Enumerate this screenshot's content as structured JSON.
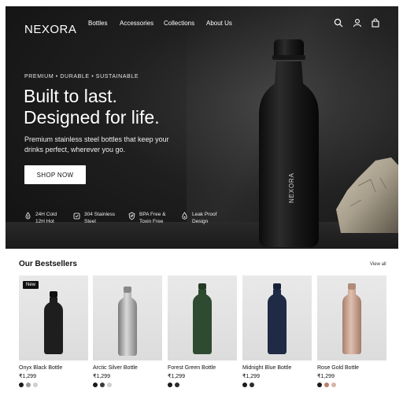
{
  "brand": "NEXORA",
  "nav": {
    "items": [
      "Bottles",
      "Accessories",
      "Collections",
      "About Us"
    ]
  },
  "header_icons": [
    "search-icon",
    "user-icon",
    "cart-icon"
  ],
  "hero": {
    "eyebrow": "PREMIUM • DURABLE • SUSTAINABLE",
    "headline_line1": "Built to last.",
    "headline_line2": "Designed for life.",
    "subcopy": "Premium stainless steel bottles that keep your drinks perfect, wherever you go.",
    "cta_label": "SHOP NOW",
    "bottle_brand": "NEXORA",
    "features": [
      {
        "icon": "thermometer-icon",
        "line1": "24H Cold",
        "line2": "12H Hot"
      },
      {
        "icon": "steel-badge-icon",
        "line1": "304 Stainless",
        "line2": "Steel"
      },
      {
        "icon": "shield-leaf-icon",
        "line1": "BPA Free &",
        "line2": "Toxin Free"
      },
      {
        "icon": "droplet-lock-icon",
        "line1": "Leak Proof",
        "line2": "Design"
      }
    ]
  },
  "bestsellers": {
    "title": "Our Bestsellers",
    "view_all": "View all",
    "products": [
      {
        "name": "Onyx Black Bottle",
        "price": "₹1,299",
        "badge": "New",
        "color": "#1e1e1e",
        "swatches": [
          "#1a1a1a",
          "#9a9a9a",
          "#d0d0d0"
        ]
      },
      {
        "name": "Arctic Silver Bottle",
        "price": "₹1,299",
        "badge": "",
        "color": "#a9a9a9",
        "swatches": [
          "#1a1a1a",
          "#3a3a3a",
          "#cfcfcf"
        ]
      },
      {
        "name": "Forest Green Bottle",
        "price": "₹1,299",
        "badge": "",
        "color": "#2e4a30",
        "swatches": [
          "#1a1a1a",
          "#2a2a2a"
        ]
      },
      {
        "name": "Midnight Blue Bottle",
        "price": "₹1,299",
        "badge": "",
        "color": "#1f2a44",
        "swatches": [
          "#1a1a1a",
          "#2a2a2a"
        ]
      },
      {
        "name": "Rose Gold Bottle",
        "price": "₹1,299",
        "badge": "",
        "color": "#c9a08e",
        "swatches": [
          "#1a1a1a",
          "#b77f6a",
          "#d8b5a4"
        ]
      }
    ]
  }
}
